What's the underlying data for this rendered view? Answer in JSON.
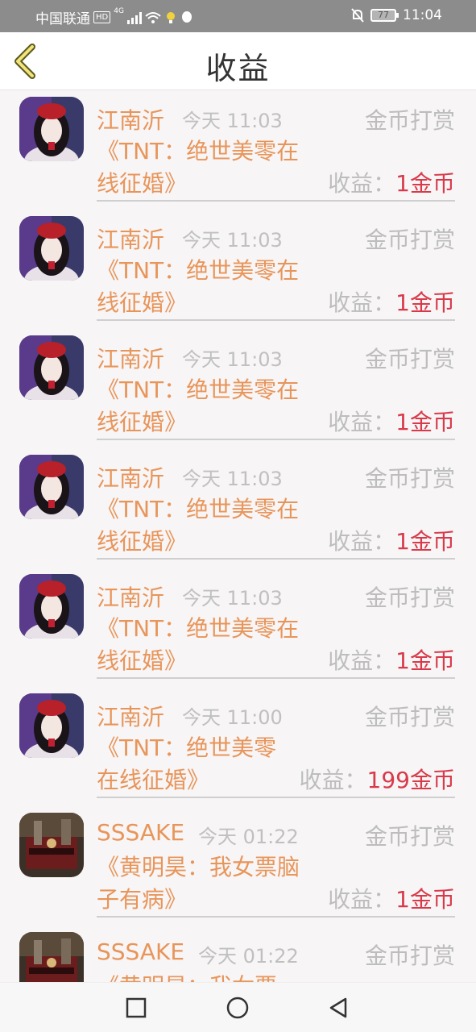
{
  "status_bar": {
    "carrier": "中国联通",
    "hd": "HD",
    "network": "4G",
    "battery": "77",
    "time": "11:04"
  },
  "header": {
    "title": "收益"
  },
  "colors": {
    "name": "#e8955a",
    "amount": "#d93a4a",
    "muted": "#bdbdbd"
  },
  "earnings": [
    {
      "user": "江南沂",
      "time": "今天 11:03",
      "type": "金币打赏",
      "book_line1": "《TNT：绝世美零在",
      "book_line2": "线征婚》",
      "earn_label": "收益：",
      "amount": "1金币",
      "avatar": "woman-portrait-icon"
    },
    {
      "user": "江南沂",
      "time": "今天 11:03",
      "type": "金币打赏",
      "book_line1": "《TNT：绝世美零在",
      "book_line2": "线征婚》",
      "earn_label": "收益：",
      "amount": "1金币",
      "avatar": "woman-portrait-icon"
    },
    {
      "user": "江南沂",
      "time": "今天 11:03",
      "type": "金币打赏",
      "book_line1": "《TNT：绝世美零在",
      "book_line2": "线征婚》",
      "earn_label": "收益：",
      "amount": "1金币",
      "avatar": "woman-portrait-icon"
    },
    {
      "user": "江南沂",
      "time": "今天 11:03",
      "type": "金币打赏",
      "book_line1": "《TNT：绝世美零在",
      "book_line2": "线征婚》",
      "earn_label": "收益：",
      "amount": "1金币",
      "avatar": "woman-portrait-icon"
    },
    {
      "user": "江南沂",
      "time": "今天 11:03",
      "type": "金币打赏",
      "book_line1": "《TNT：绝世美零在",
      "book_line2": "线征婚》",
      "earn_label": "收益：",
      "amount": "1金币",
      "avatar": "woman-portrait-icon"
    },
    {
      "user": "江南沂",
      "time": "今天 11:00",
      "type": "金币打赏",
      "book_line1": "《TNT：绝世美零",
      "book_line2": "在线征婚》",
      "earn_label": "收益：",
      "amount": "199金币",
      "avatar": "woman-portrait-icon"
    },
    {
      "user": "SSSAKE",
      "time": "今天 01:22",
      "type": "金币打赏",
      "book_line1": "《黄明昊：我女票脑",
      "book_line2": "子有病》",
      "earn_label": "收益：",
      "amount": "1金币",
      "avatar": "train-station-icon"
    },
    {
      "user": "SSSAKE",
      "time": "今天 01:22",
      "type": "金币打赏",
      "book_line1": "《黄明昊：我女票",
      "book_line2": "",
      "earn_label": "",
      "amount": "",
      "avatar": "train-station-icon"
    }
  ],
  "nav": {
    "recent": "square-icon",
    "home": "circle-icon",
    "back": "triangle-back-icon"
  }
}
